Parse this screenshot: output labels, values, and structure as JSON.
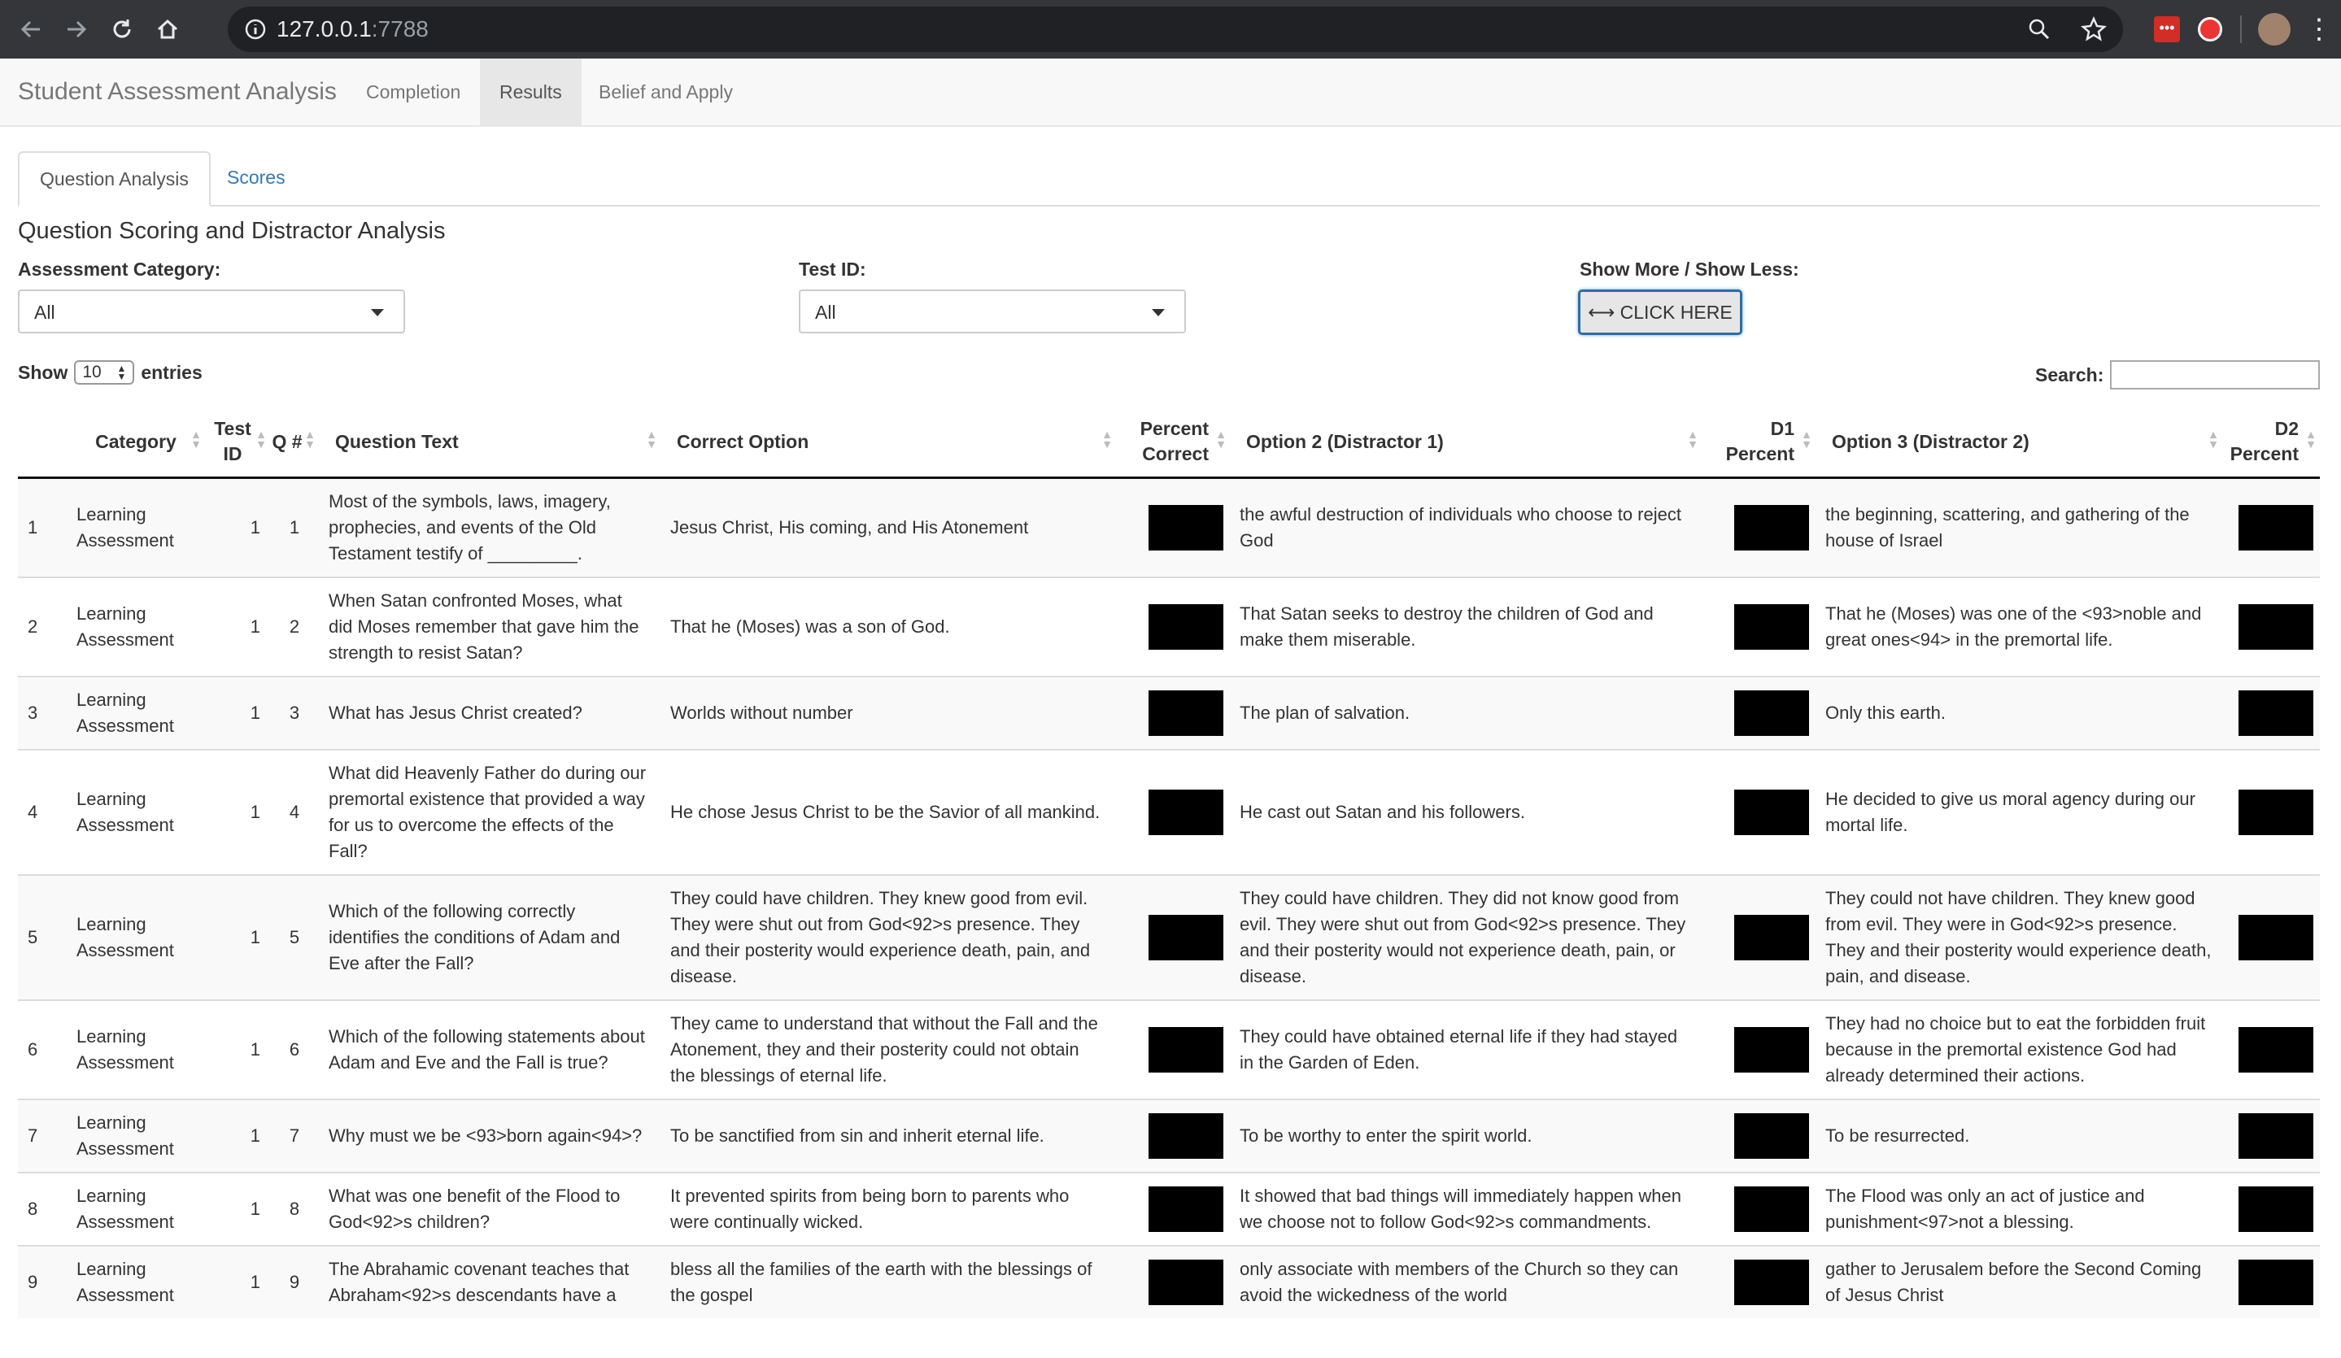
{
  "browser": {
    "url_host": "127.0.0.1",
    "url_port": ":7788"
  },
  "app": {
    "brand": "Student Assessment Analysis",
    "nav": [
      "Completion",
      "Results",
      "Belief and Apply"
    ],
    "active_nav": "Results"
  },
  "tabs": [
    "Question Analysis",
    "Scores"
  ],
  "section_title": "Question Scoring and Distractor Analysis",
  "filters": {
    "category_label": "Assessment Category:",
    "category_value": "All",
    "testid_label": "Test ID:",
    "testid_value": "All",
    "showmore_label": "Show More / Show Less:",
    "button_label": "⟷ CLICK HERE"
  },
  "table_controls": {
    "show": "Show",
    "entries_value": "10",
    "entries": "entries",
    "search_label": "Search:"
  },
  "columns": [
    "",
    "Category",
    "Test ID",
    "Q #",
    "Question Text",
    "Correct Option",
    "Percent Correct",
    "Option 2 (Distractor 1)",
    "D1 Percent",
    "Option 3 (Distractor 2)",
    "D2 Percent"
  ],
  "rows": [
    {
      "n": "1",
      "cat": "Learning Assessment",
      "tid": "1",
      "q": "1",
      "text": "Most of the symbols, laws, imagery, prophecies, and events of the Old Testament testify of _________.",
      "correct": "Jesus Christ, His coming, and His Atonement",
      "d1": "the awful destruction of individuals who choose to reject God",
      "d2": "the beginning, scattering, and gathering of the house of Israel"
    },
    {
      "n": "2",
      "cat": "Learning Assessment",
      "tid": "1",
      "q": "2",
      "text": "When Satan confronted Moses, what did Moses remember that gave him the strength to resist Satan?",
      "correct": "That he (Moses) was a son of God.",
      "d1": "That Satan seeks to destroy the children of God and make them miserable.",
      "d2": "That he (Moses) was one of the <93>noble and great ones<94> in the premortal life."
    },
    {
      "n": "3",
      "cat": "Learning Assessment",
      "tid": "1",
      "q": "3",
      "text": "What has Jesus Christ created?",
      "correct": "Worlds without number",
      "d1": "The plan of salvation.",
      "d2": "Only this earth."
    },
    {
      "n": "4",
      "cat": "Learning Assessment",
      "tid": "1",
      "q": "4",
      "text": "What did Heavenly Father do during our premortal existence that provided a way for us to overcome the effects of the Fall?",
      "correct": "He chose Jesus Christ to be the Savior of all mankind.",
      "d1": "He cast out Satan and his followers.",
      "d2": "He decided to give us moral agency during our mortal life."
    },
    {
      "n": "5",
      "cat": "Learning Assessment",
      "tid": "1",
      "q": "5",
      "text": "Which of the following correctly identifies the conditions of Adam and Eve after the Fall?",
      "correct": "They could have children. They knew good from evil. They were shut out from God<92>s presence. They and their posterity would experience death, pain, and disease.",
      "d1": "They could have children. They did not know good from evil. They were shut out from God<92>s presence. They and their posterity would not experience death, pain, or disease.",
      "d2": "They could not have children. They knew good from evil. They were in God<92>s presence. They and their posterity would experience death, pain, and disease."
    },
    {
      "n": "6",
      "cat": "Learning Assessment",
      "tid": "1",
      "q": "6",
      "text": "Which of the following statements about Adam and Eve and the Fall is true?",
      "correct": "They came to understand that without the Fall and the Atonement, they and their posterity could not obtain the blessings of eternal life.",
      "d1": "They could have obtained eternal life if they had stayed in the Garden of Eden.",
      "d2": "They had no choice but to eat the forbidden fruit because in the premortal existence God had already determined their actions."
    },
    {
      "n": "7",
      "cat": "Learning Assessment",
      "tid": "1",
      "q": "7",
      "text": "Why must we be <93>born again<94>?",
      "correct": "To be sanctified from sin and inherit eternal life.",
      "d1": "To be worthy to enter the spirit world.",
      "d2": "To be resurrected."
    },
    {
      "n": "8",
      "cat": "Learning Assessment",
      "tid": "1",
      "q": "8",
      "text": "What was one benefit of the Flood to God<92>s children?",
      "correct": "It prevented spirits from being born to parents who were continually wicked.",
      "d1": "It showed that bad things will immediately happen when we choose not to follow God<92>s commandments.",
      "d2": "The Flood was only an act of justice and punishment<97>not a blessing."
    },
    {
      "n": "9",
      "cat": "Learning Assessment",
      "tid": "1",
      "q": "9",
      "text": "The Abrahamic covenant teaches that Abraham<92>s descendants have a",
      "correct": "bless all the families of the earth with the blessings of the gospel",
      "d1": "only associate with members of the Church so they can avoid the wickedness of the world",
      "d2": "gather to Jerusalem before the Second Coming of Jesus Christ"
    }
  ]
}
